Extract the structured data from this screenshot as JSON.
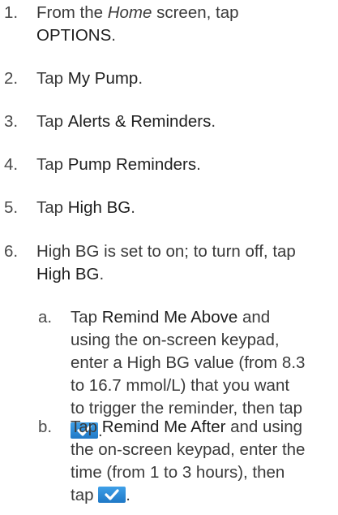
{
  "steps": [
    {
      "num": "1.",
      "pre": "From the ",
      "em": "Home",
      "mid": " screen, tap",
      "bold": "OPTIONS",
      "post": "."
    },
    {
      "num": "2.",
      "pre": "Tap ",
      "bold": "My Pump",
      "post": "."
    },
    {
      "num": "3.",
      "pre": "Tap ",
      "bold": "Alerts & Reminders",
      "post": "."
    },
    {
      "num": "4.",
      "pre": "Tap ",
      "bold": "Pump Reminders",
      "post": "."
    },
    {
      "num": "5.",
      "pre": "Tap ",
      "bold": "High BG",
      "post": "."
    },
    {
      "num": "6.",
      "pre": "High BG is set to on; to turn off, tap",
      "bold": "High BG",
      "post": "."
    }
  ],
  "substeps": [
    {
      "num": "a.",
      "pre": "Tap ",
      "bold": "Remind Me Above",
      "line1_post": " and",
      "line2": "using the on-screen keypad,",
      "line3": "enter a High BG value (from 8.3",
      "line4": "to 16.7 mmol/L) that you want",
      "line5": "to trigger the reminder, then tap",
      "end": "."
    },
    {
      "num": "b.",
      "pre": "Tap ",
      "bold": "Remind Me After",
      "line1_post": " and using",
      "line2": "the on-screen keypad, enter the",
      "line3": "time (from 1 to 3 hours), then",
      "line4": "tap ",
      "end": "."
    }
  ],
  "icons": {
    "confirm": "checkmark-icon"
  },
  "colors": {
    "confirm_button": "#2a8ad8"
  }
}
